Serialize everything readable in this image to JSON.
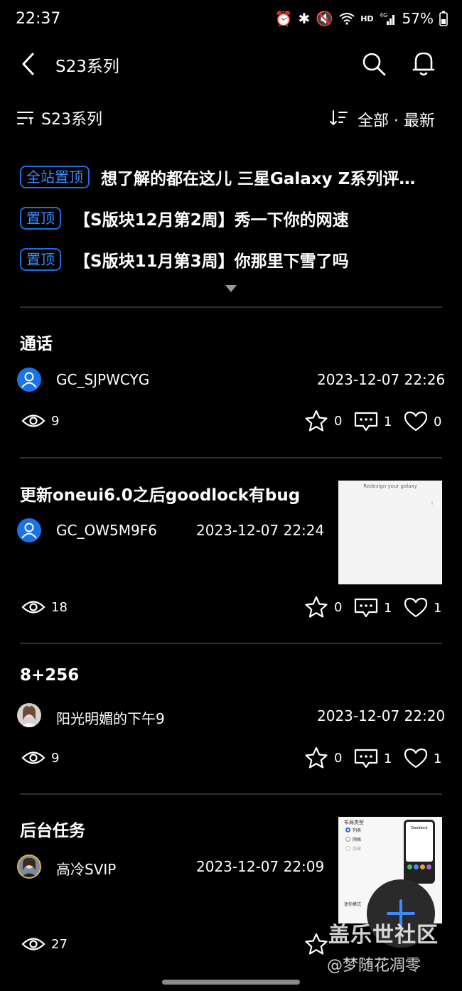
{
  "status_bar": {
    "time": "22:37",
    "hd": "HD",
    "network": "4G",
    "battery": "57%"
  },
  "header": {
    "title": "S23系列"
  },
  "filter": {
    "label": "S23系列",
    "sort": "全部 · 最新"
  },
  "pinned": [
    {
      "tag": "全站置顶",
      "title": "想了解的都在这儿 三星Galaxy Z系列评…"
    },
    {
      "tag": "置顶",
      "title": "【S版块12月第2周】秀一下你的网速"
    },
    {
      "tag": "置顶",
      "title": "【S版块11月第3周】你那里下雪了吗"
    }
  ],
  "posts": [
    {
      "title": "通话",
      "user": "GC_SJPWCYG",
      "time": "2023-12-07 22:26",
      "views": "9",
      "favorites": "0",
      "comments": "1",
      "likes": "0"
    },
    {
      "title": "更新oneui6.0之后goodlock有bug",
      "user": "GC_OW5M9F6",
      "time": "2023-12-07 22:24",
      "views": "18",
      "favorites": "0",
      "comments": "1",
      "likes": "1",
      "thumb_caption": "Redesign your galaxy"
    },
    {
      "title": "8+256",
      "user": "阳光明媚的下午9",
      "time": "2023-12-07 22:20",
      "views": "9",
      "favorites": "0",
      "comments": "1",
      "likes": "1"
    },
    {
      "title": "后台任务",
      "user": "高冷SVIP",
      "time": "2023-12-07 22:09",
      "views": "27",
      "favorites": "",
      "comments": "",
      "likes": "",
      "thumb_lines": [
        "布局类型",
        "列表",
        "网格",
        "隐藏",
        "迷你模式"
      ],
      "thumb_app": "Goodlock"
    }
  ],
  "watermark": {
    "line1": "盖乐世社区",
    "line2": "@梦随花凋零"
  },
  "colors": {
    "accent": "#1e6fd9",
    "avatar_blue": "#1a73e8",
    "divider": "#2e2e2e"
  }
}
